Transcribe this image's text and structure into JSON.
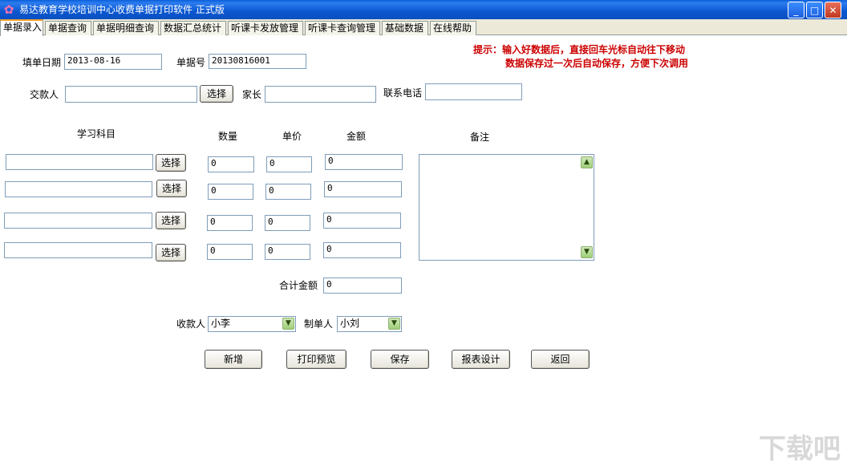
{
  "window": {
    "title": "易达教育学校培训中心收费单据打印软件  正式版",
    "minimize": "_",
    "maximize": "□",
    "close": "✕"
  },
  "tabs": [
    "单据录入",
    "单据查询",
    "单据明细查询",
    "数据汇总统计",
    "听课卡发放管理",
    "听课卡查询管理",
    "基础数据",
    "在线帮助"
  ],
  "hint": {
    "line1": "提示：输入好数据后，直接回车光标自动往下移动",
    "line2": "数据保存过一次后自动保存，方便下次调用"
  },
  "form": {
    "date_label": "填单日期",
    "date_value": "2013-08-16",
    "number_label": "单据号",
    "number_value": "20130816001",
    "payer_label": "交款人",
    "payer_value": "",
    "parent_label": "家长",
    "parent_value": "",
    "phone_label": "联系电话",
    "phone_value": "",
    "choose_label": "选择"
  },
  "columns": {
    "subject": "学习科目",
    "qty": "数量",
    "price": "单价",
    "amount": "金额",
    "remarks": "备注"
  },
  "rows": [
    {
      "subject": "",
      "qty": "0",
      "price": "0",
      "amount": "0"
    },
    {
      "subject": "",
      "qty": "0",
      "price": "0",
      "amount": "0"
    },
    {
      "subject": "",
      "qty": "0",
      "price": "0",
      "amount": "0"
    },
    {
      "subject": "",
      "qty": "0",
      "price": "0",
      "amount": "0"
    }
  ],
  "total": {
    "label": "合计金额",
    "value": "0"
  },
  "receiver": {
    "label": "收款人",
    "value": "小李"
  },
  "maker": {
    "label": "制单人",
    "value": "小刘"
  },
  "actions": {
    "new": "新增",
    "print_preview": "打印预览",
    "save": "保存",
    "report_design": "报表设计",
    "back": "返回"
  },
  "watermark": "下载吧",
  "icons": {
    "app": "app-flower-icon",
    "dropdown": "chevron-down-icon",
    "scroll_up": "scroll-up-icon",
    "scroll_down": "scroll-down-icon"
  }
}
